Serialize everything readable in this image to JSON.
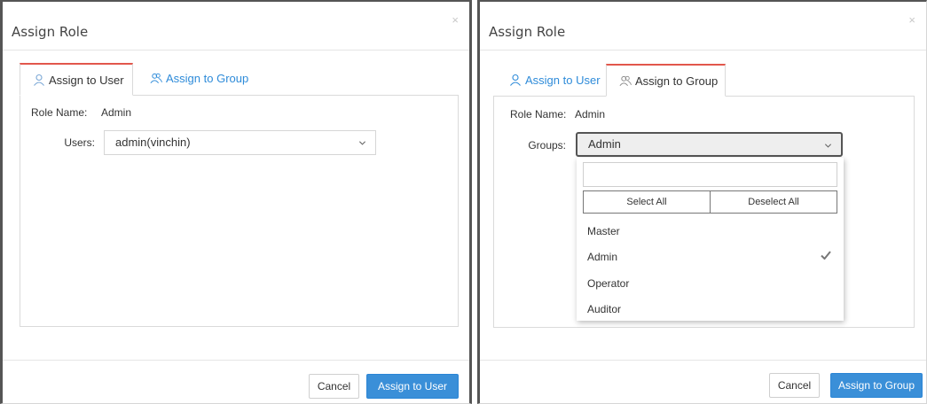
{
  "dialogs": [
    {
      "title": "Assign Role",
      "close_glyph": "×",
      "tabs": [
        {
          "label": "Assign to User",
          "icon": "user-icon",
          "active": true
        },
        {
          "label": "Assign to Group",
          "icon": "users-icon",
          "active": false
        }
      ],
      "role_name_label": "Role Name:",
      "role_name_value": "Admin",
      "field_label": "Users:",
      "field_value": "admin(vinchin)",
      "cancel_label": "Cancel",
      "primary_label": "Assign to User"
    },
    {
      "title": "Assign Role",
      "close_glyph": "×",
      "tabs": [
        {
          "label": "Assign to User",
          "icon": "user-icon",
          "active": false
        },
        {
          "label": "Assign to Group",
          "icon": "users-icon",
          "active": true
        }
      ],
      "role_name_label": "Role Name:",
      "role_name_value": "Admin",
      "field_label": "Groups:",
      "field_value": "Admin",
      "dropdown": {
        "search_placeholder": "",
        "select_all_label": "Select All",
        "deselect_all_label": "Deselect All",
        "options": [
          {
            "label": "Master",
            "checked": false
          },
          {
            "label": "Admin",
            "checked": true
          },
          {
            "label": "Operator",
            "checked": false
          },
          {
            "label": "Auditor",
            "checked": false
          }
        ]
      },
      "cancel_label": "Cancel",
      "primary_label": "Assign to Group"
    }
  ],
  "colors": {
    "primary": "#3a8fd8",
    "tab_active_border": "#e2574c",
    "link": "#2e8bd9"
  }
}
